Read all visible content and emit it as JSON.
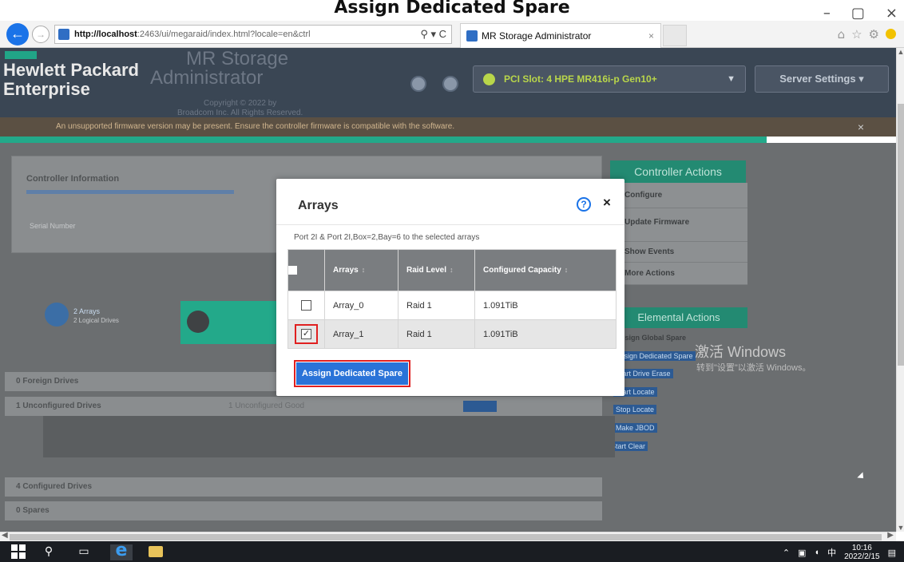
{
  "step_heading": "Assign Dedicated Spare",
  "window_controls": {
    "minimize": "–",
    "restore": "▢",
    "close": "×"
  },
  "browser": {
    "url_host": "http://localhost",
    "url_rest": ":2463/ui/megaraid/index.html?locale=en&ctrl",
    "url_controls": "⚲ ▾ C",
    "tab_title": "MR Storage Administrator",
    "tab_close": "×"
  },
  "app": {
    "brand_line1": "Hewlett Packard",
    "brand_line2": "Enterprise",
    "title_line1": "MR Storage",
    "title_line2": "Administrator",
    "copyright": "Copyright © 2022 by",
    "rights": "Broadcom Inc. All Rights Reserved.",
    "controller_selector": "PCI Slot: 4 HPE MR416i-p Gen10+",
    "server_settings": "Server Settings",
    "warning": "An unsupported firmware version may be present. Ensure the controller firmware is compatible with the software.",
    "warning_close": "×"
  },
  "background": {
    "controller_info": "Controller Information",
    "serial_label": "Serial Number",
    "arrays_summary": "2 Arrays",
    "logical_summary": "2 Logical Drives",
    "controller_actions_title": "Controller Actions",
    "controller_actions": [
      "Configure",
      "Update Firmware",
      "Show Events",
      "More Actions"
    ],
    "elemental_actions_title": "Elemental Actions",
    "elemental_actions": [
      "Assign Global Spare",
      "Assign Dedicated Spare",
      "Start Drive Erase",
      "Start Locate",
      "Stop Locate",
      "Make JBOD",
      "Start Clear"
    ],
    "rows": [
      "0 Foreign Drives",
      "1 Unconfigured Drives",
      "4 Configured Drives",
      "0 Spares"
    ],
    "unconfigured_note": "1 Unconfigured Good"
  },
  "modal": {
    "title": "Arrays",
    "subtitle": "Port 2I & Port 2I,Box=2,Bay=6 to the selected arrays",
    "help_glyph": "?",
    "close_glyph": "×",
    "columns": [
      "Arrays",
      "Raid Level",
      "Configured Capacity"
    ],
    "sort_glyph": "↕",
    "rows": [
      {
        "array": "Array_0",
        "raid": "Raid 1",
        "capacity": "1.091TiB",
        "checked": false
      },
      {
        "array": "Array_1",
        "raid": "Raid 1",
        "capacity": "1.091TiB",
        "checked": true
      }
    ],
    "assign_button": "Assign Dedicated Spare"
  },
  "watermark": {
    "line1": "激活 Windows",
    "line2": "转到\"设置\"以激活 Windows。"
  },
  "taskbar": {
    "time": "10:16",
    "date": "2022/2/15",
    "ime": "中"
  },
  "colors": {
    "accent_blue": "#2a73d8",
    "highlight_red": "#e02020",
    "hpe_green": "#21a587"
  }
}
